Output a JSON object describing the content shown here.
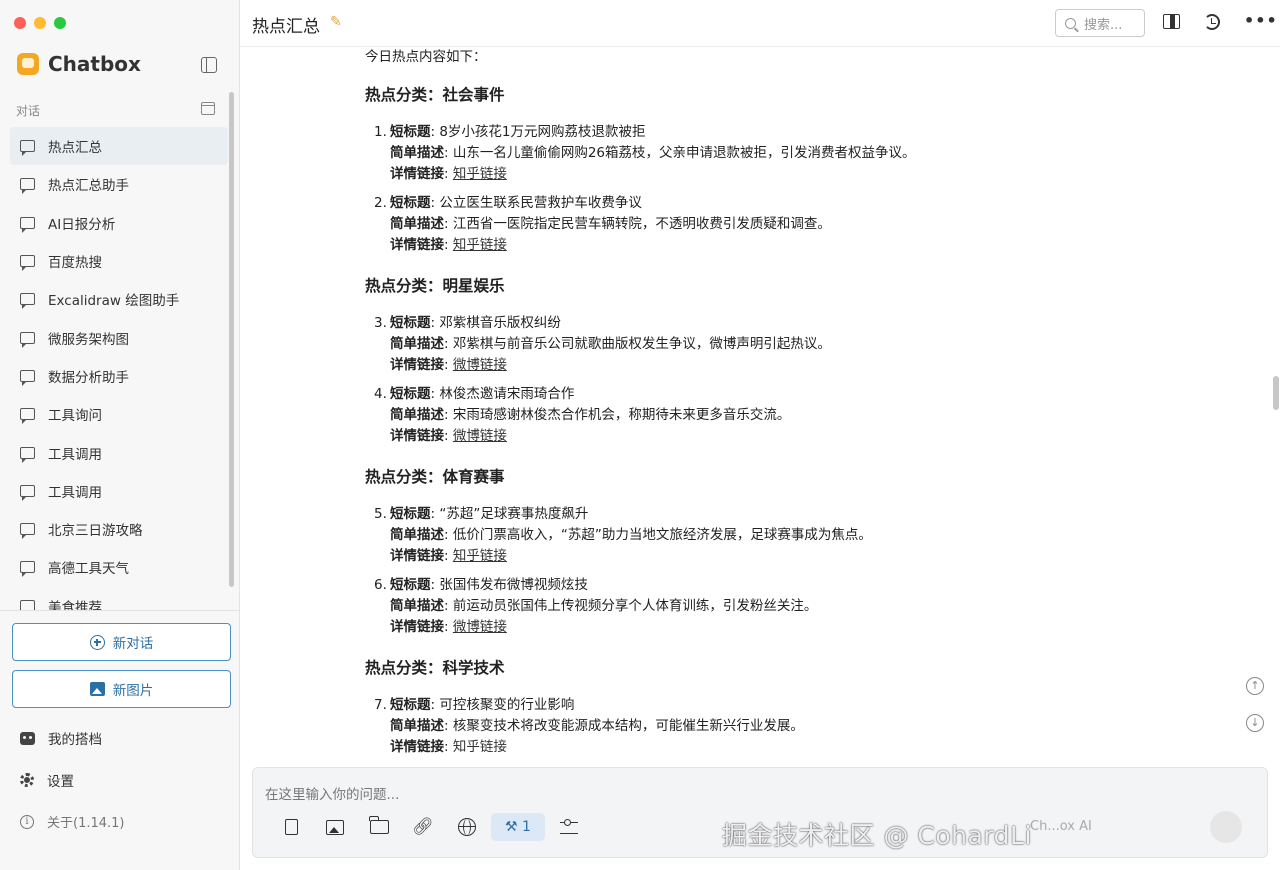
{
  "app": {
    "name": "Chatbox",
    "version_label": "关于(1.14.1)"
  },
  "sidebar": {
    "section_label": "对话",
    "conversations": [
      "热点汇总",
      "热点汇总助手",
      "AI日报分析",
      "百度热搜",
      "Excalidraw 绘图助手",
      "微服务架构图",
      "数据分析助手",
      "工具询问",
      "工具调用",
      "工具调用",
      "北京三日游攻略",
      "高德工具天气",
      "美食推荐"
    ],
    "new_chat": "新对话",
    "new_image": "新图片",
    "my_partner": "我的搭档",
    "settings": "设置"
  },
  "header": {
    "title": "热点汇总",
    "search_placeholder": "搜索..."
  },
  "message": {
    "intro": "今日热点内容如下：",
    "labels": {
      "title": "短标题",
      "desc": "简单描述",
      "link": "详情链接"
    },
    "categories": [
      {
        "heading": "热点分类：社会事件"
      },
      {
        "heading": "热点分类：明星娱乐"
      },
      {
        "heading": "热点分类：体育赛事"
      },
      {
        "heading": "热点分类：科学技术"
      }
    ],
    "items": [
      {
        "num": "1.",
        "title": "8岁小孩花1万元网购荔枝退款被拒",
        "desc": "山东一名儿童偷偷网购26箱荔枝，父亲申请退款被拒，引发消费者权益争议。",
        "link": "知乎链接"
      },
      {
        "num": "2.",
        "title": "公立医生联系民营救护车收费争议",
        "desc": "江西省一医院指定民营车辆转院，不透明收费引发质疑和调查。",
        "link": "知乎链接"
      },
      {
        "num": "3.",
        "title": "邓紫棋音乐版权纠纷",
        "desc": "邓紫棋与前音乐公司就歌曲版权发生争议，微博声明引起热议。",
        "link": "微博链接"
      },
      {
        "num": "4.",
        "title": "林俊杰邀请宋雨琦合作",
        "desc": "宋雨琦感谢林俊杰合作机会，称期待未来更多音乐交流。",
        "link": "微博链接"
      },
      {
        "num": "5.",
        "title": "“苏超”足球赛事热度飙升",
        "desc": "低价门票高收入，“苏超”助力当地文旅经济发展，足球赛事成为焦点。",
        "link": "知乎链接"
      },
      {
        "num": "6.",
        "title": "张国伟发布微博视频炫技",
        "desc": "前运动员张国伟上传视频分享个人体育训练，引发粉丝关注。",
        "link": "微博链接"
      },
      {
        "num": "7.",
        "title": "可控核聚变的行业影响",
        "desc": "核聚变技术将改变能源成本结构，可能催生新兴行业发展。",
        "link": "知乎链接"
      }
    ]
  },
  "input": {
    "placeholder": "在这里输入你的问题...",
    "tool_count": "1",
    "provider_label": "Ch...ox AI",
    "watermark": "掘金技术社区 @ CohardLi"
  },
  "colors": {
    "accent": "#2c6fa6",
    "active_item_bg": "#e9eef3",
    "sidebar_bg": "#f7f7f7"
  }
}
